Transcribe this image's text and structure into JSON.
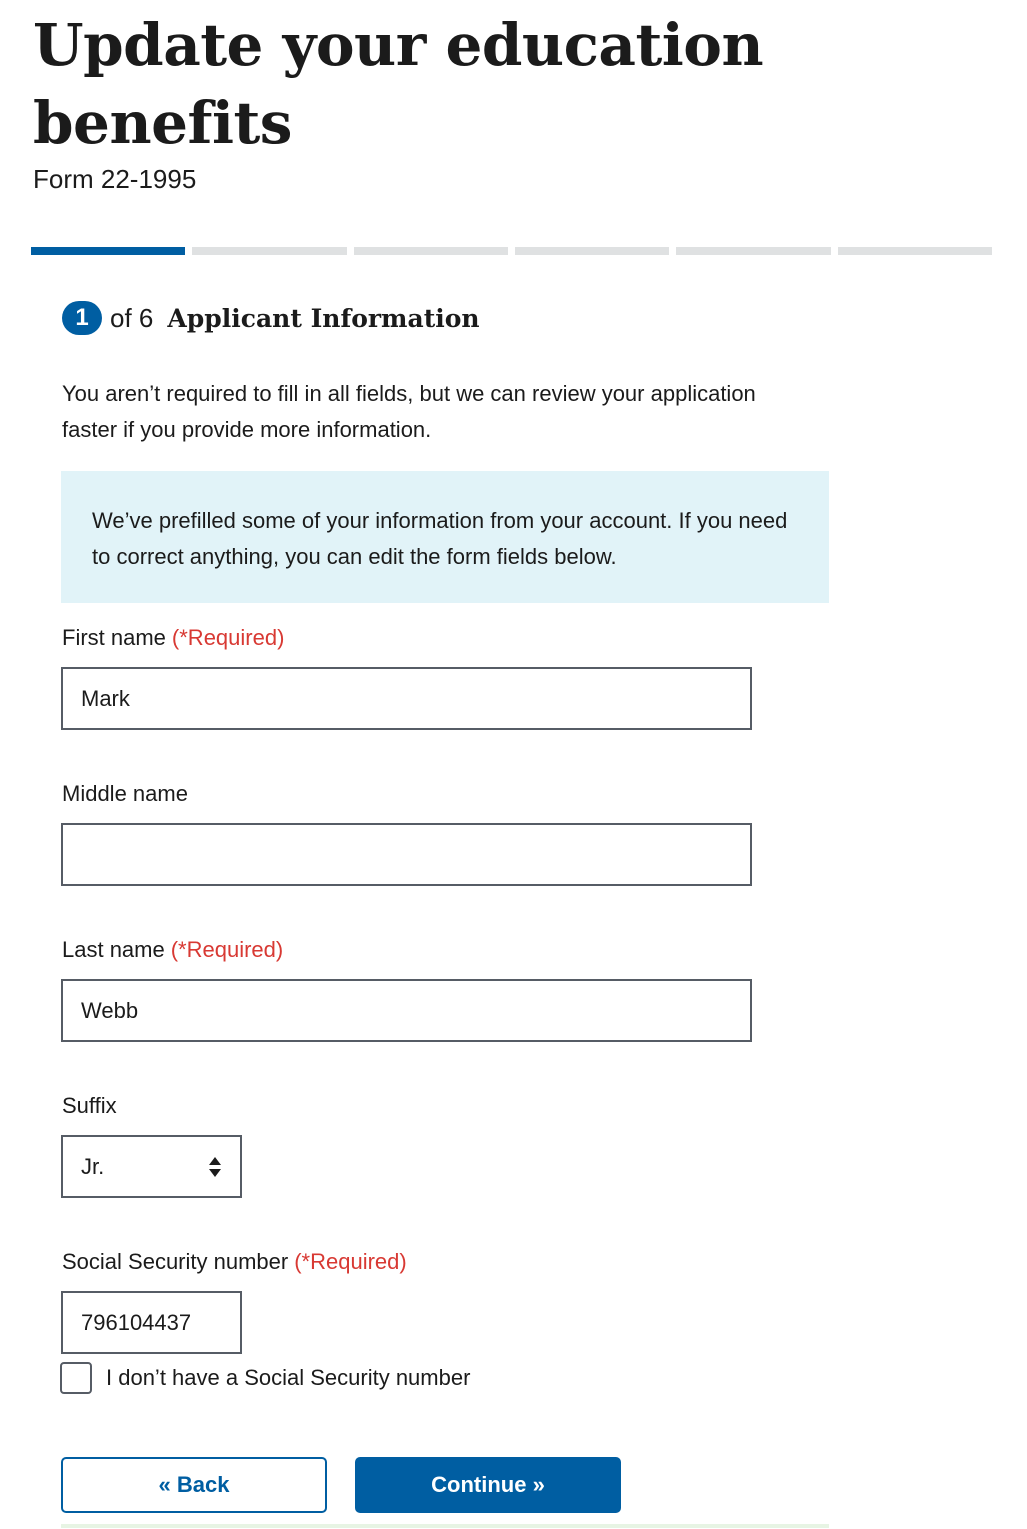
{
  "page": {
    "title": "Update your education benefits",
    "subtitle": "Form 22-1995"
  },
  "progress": {
    "total_segments": 6,
    "current_segment": 1
  },
  "step": {
    "number": "1",
    "of_text": "of 6",
    "title": "Applicant Information"
  },
  "intro_text": "You aren’t required to fill in all fields, but we can review your application faster if you provide more information.",
  "alert_text": "We’ve prefilled some of your information from your account. If you need to correct anything, you can edit the form fields below.",
  "required_marker": "(*Required)",
  "fields": {
    "first_name": {
      "label": "First name",
      "value": "Mark"
    },
    "middle_name": {
      "label": "Middle name",
      "value": ""
    },
    "last_name": {
      "label": "Last name",
      "value": "Webb"
    },
    "suffix": {
      "label": "Suffix",
      "value": "Jr."
    },
    "ssn": {
      "label": "Social Security number",
      "value": "796104437"
    }
  },
  "no_ssn_checkbox": {
    "label": "I don’t have a Social Security number",
    "checked": false
  },
  "buttons": {
    "back": "« Back",
    "continue": "Continue »"
  },
  "colors": {
    "primary": "#005ea2",
    "required": "#d83933",
    "alert_bg": "#e1f3f8",
    "progress_inactive": "#dfe1e2"
  },
  "icons": {
    "suffix_select": "sort-arrows-icon"
  }
}
